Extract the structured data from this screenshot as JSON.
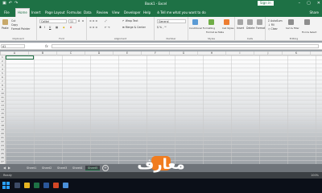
{
  "title_bar": {
    "quick_access": [
      "save",
      "undo",
      "redo"
    ],
    "title": "Book1 - Excel",
    "sign_in": "Sign in",
    "window_buttons": [
      "minimize",
      "restore",
      "close"
    ]
  },
  "tabs": [
    "File",
    "Home",
    "Insert",
    "Page Layout",
    "Formulas",
    "Data",
    "Review",
    "View",
    "Developer",
    "Help"
  ],
  "active_tab": "Home",
  "tell_me": "Tell me what you want to do",
  "share": "Share",
  "ribbon": {
    "clipboard": {
      "paste": "Paste",
      "cut": "Cut",
      "copy": "Copy",
      "format_painter": "Format Painter",
      "label": "Clipboard"
    },
    "font": {
      "name": "Calibri",
      "size": "11",
      "label": "Font"
    },
    "alignment": {
      "wrap": "Wrap Text",
      "merge": "Merge & Center",
      "label": "Alignment"
    },
    "number": {
      "format": "General",
      "label": "Number"
    },
    "styles": {
      "conditional": "Conditional Formatting",
      "format_table": "Format as Table",
      "cell_styles": "Cell Styles",
      "label": "Styles"
    },
    "cells": {
      "insert": "Insert",
      "delete": "Delete",
      "format": "Format",
      "label": "Cells"
    },
    "editing": {
      "autosum": "AutoSum",
      "fill": "Fill",
      "clear": "Clear",
      "sort": "Sort & Filter",
      "find": "Find & Select",
      "label": "Editing"
    }
  },
  "formula_bar": {
    "name_box": "A1",
    "fx": "fx",
    "value": ""
  },
  "columns": [
    "A",
    "B",
    "C",
    "D",
    "E",
    "F",
    "G",
    "H",
    "I",
    "J",
    "K",
    "L",
    "M",
    "N",
    "O",
    "P",
    "Q",
    "R",
    "S",
    "T"
  ],
  "rows": [
    "1",
    "2",
    "3",
    "4",
    "5",
    "6",
    "7",
    "8",
    "9",
    "10",
    "11",
    "12",
    "13",
    "14",
    "15",
    "16",
    "17",
    "18",
    "19",
    "20",
    "21",
    "22",
    "23",
    "24",
    "25",
    "26",
    "27"
  ],
  "sheets": [
    "Sheet1",
    "Sheet2",
    "Sheet3",
    "Sheet4",
    "Sheet5"
  ],
  "active_sheet": "Sheet5",
  "status": {
    "left": "Ready",
    "zoom": "100%"
  },
  "logo": {
    "text": "معارف",
    "color_main": "#ffffff",
    "color_accent": "#f07c1f"
  },
  "colors": {
    "excel_green": "#1e7145",
    "taskbar": "#0b0f18"
  }
}
